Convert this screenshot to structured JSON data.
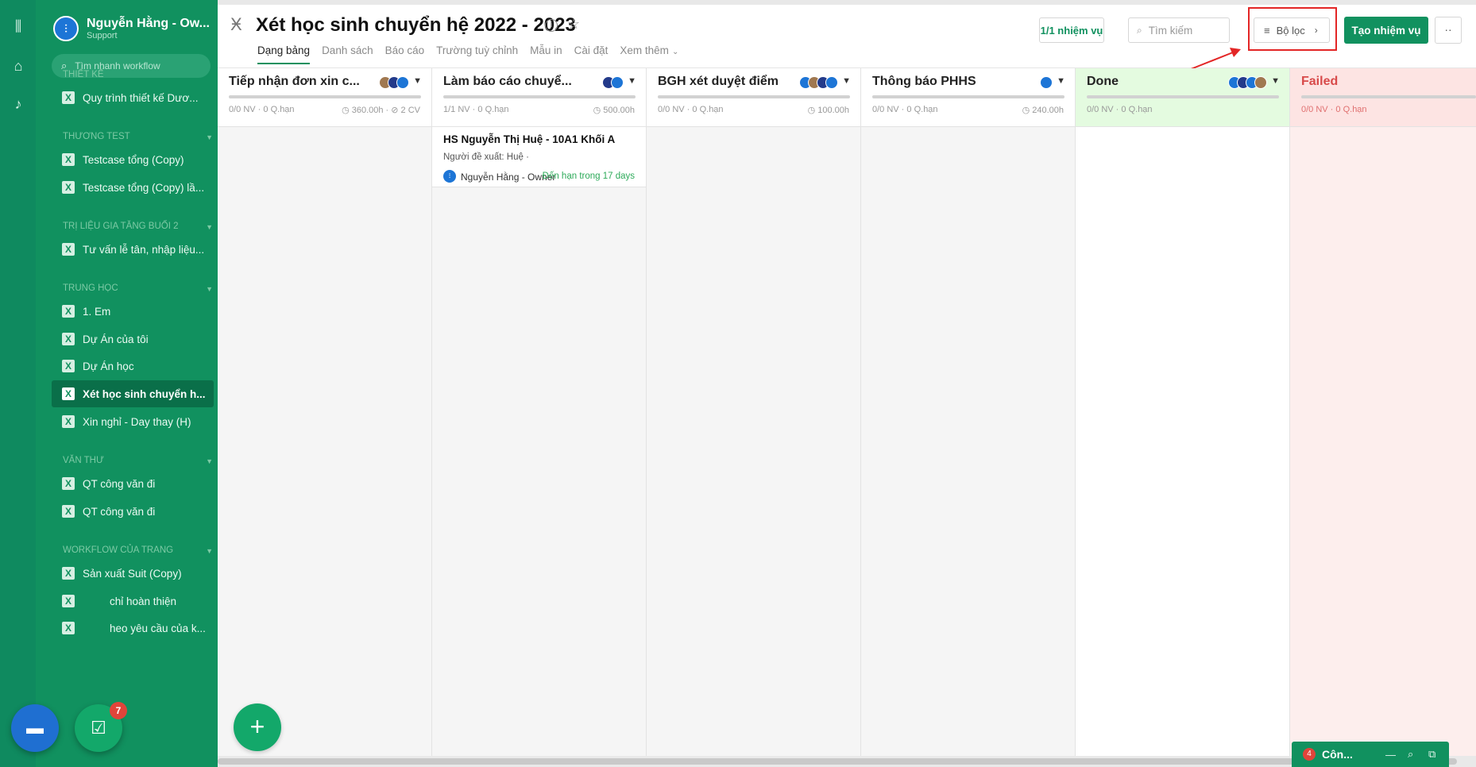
{
  "sidebar": {
    "profile_name": "Nguyễn Hằng - Ow...",
    "profile_role": "Support",
    "quick_search_placeholder": "Tìm nhanh workflow",
    "groups": [
      {
        "label": "THIẾT KẾ"
      },
      {
        "label": "THƯƠNG TEST"
      },
      {
        "label": "TRỊ LIỆU GIA TĂNG BUỔI 2"
      },
      {
        "label": "TRUNG HỌC"
      },
      {
        "label": "VĂN THƯ"
      },
      {
        "label": "WORKFLOW CỦA TRANG"
      }
    ],
    "items": [
      {
        "label": "Quy trình thiết kế Dươ..."
      },
      {
        "label": "Testcase tổng (Copy)"
      },
      {
        "label": "Testcase tổng (Copy) lầ..."
      },
      {
        "label": "Tư vấn lễ tân, nhập liệu..."
      },
      {
        "label": "1. Em"
      },
      {
        "label": "Dự Án của tôi"
      },
      {
        "label": "Dự Án học"
      },
      {
        "label": "Xét học sinh chuyển h..."
      },
      {
        "label": "Xin nghỉ - Day thay (H)"
      },
      {
        "label": "QT công văn đi"
      },
      {
        "label": "QT công văn đi"
      },
      {
        "label": "Sản xuất Suit (Copy)"
      },
      {
        "label": "chỉ hoàn thiện"
      },
      {
        "label": "heo yêu cầu của k..."
      }
    ]
  },
  "header": {
    "title": "Xét học sinh chuyển hệ 2022 - 2023",
    "tabs": [
      {
        "label": "Dạng bảng"
      },
      {
        "label": "Danh sách"
      },
      {
        "label": "Báo cáo"
      },
      {
        "label": "Trường tuỳ chỉnh"
      },
      {
        "label": "Mẫu in"
      },
      {
        "label": "Cài đặt"
      },
      {
        "label": "Xem thêm"
      }
    ],
    "task_count": "1/1 nhiệm vụ",
    "search_placeholder": "Tìm kiếm",
    "filter_label": "Bộ lọc",
    "create_label": "Tạo nhiệm vụ",
    "more_label": "··"
  },
  "columns": [
    {
      "title": "Tiếp nhận đơn xin c...",
      "stats": "0/0 NV · 0 Q.hạn",
      "hours": "◷ 360.00h · ⊘ 2 CV"
    },
    {
      "title": "Làm báo cáo chuyể...",
      "stats": "1/1 NV · 0 Q.hạn",
      "hours": "◷ 500.00h"
    },
    {
      "title": "BGH xét duyệt điểm",
      "stats": "0/0 NV · 0 Q.hạn",
      "hours": "◷ 100.00h"
    },
    {
      "title": "Thông báo PHHS",
      "stats": "0/0 NV · 0 Q.hạn",
      "hours": "◷ 240.00h"
    },
    {
      "title": "Done",
      "stats": "0/0 NV · 0 Q.hạn",
      "hours": ""
    },
    {
      "title": "Failed",
      "stats": "0/0 NV · 0 Q.hạn",
      "hours": ""
    }
  ],
  "card": {
    "title": "HS Nguyễn Thị Huệ - 10A1 Khối A",
    "proposer": "Người đề xuất: Huệ ·",
    "owner": "Nguyễn Hằng - Owner",
    "due": "Đến hạn trong 17 days"
  },
  "floating": {
    "task_badge": "7",
    "add_label": "+",
    "mini_chat_badge": "4",
    "mini_chat_label": "Côn..."
  },
  "colors": {
    "brand": "#11915f",
    "sidebar_bg": "#11915f",
    "create_button": "#11915f",
    "done_header": "#e4fbe0",
    "failed_header": "#fde4e3",
    "highlight_box": "#e32626"
  }
}
